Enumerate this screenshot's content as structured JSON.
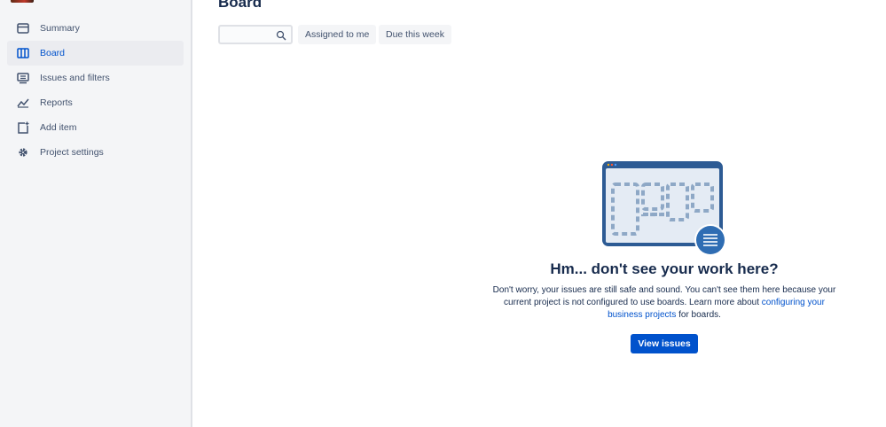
{
  "sidebar": {
    "items": [
      {
        "label": "Summary",
        "icon": "summary-icon"
      },
      {
        "label": "Board",
        "icon": "board-icon",
        "active": true
      },
      {
        "label": "Issues and filters",
        "icon": "issues-icon"
      },
      {
        "label": "Reports",
        "icon": "reports-icon"
      },
      {
        "label": "Add item",
        "icon": "add-item-icon"
      },
      {
        "label": "Project settings",
        "icon": "gear-icon"
      }
    ]
  },
  "main": {
    "title": "Board",
    "search": {
      "placeholder": "",
      "value": "",
      "icon": "search-icon"
    },
    "filters": {
      "assigned_label": "Assigned to me",
      "due_label": "Due this week"
    }
  },
  "empty_state": {
    "illustration": "board-window-illustration",
    "heading": "Hm... don't see your work here?",
    "text_before": "Don't worry, your issues are still safe and sound. You can't see them here because your current project is not configured to use boards. Learn more about ",
    "link_text": "configuring your business projects",
    "text_after": " for boards.",
    "button_label": "View issues"
  },
  "colors": {
    "primary": "#0052cc",
    "sidebar_bg": "#f4f5f7",
    "illustration_blue": "#2d5b94",
    "illustration_dash": "#8ea8c6"
  }
}
